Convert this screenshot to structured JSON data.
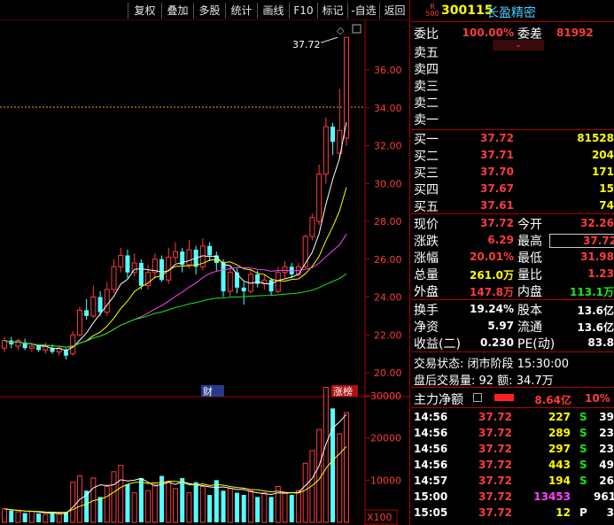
{
  "toolbar": [
    {
      "label": "复权"
    },
    {
      "label": "叠加"
    },
    {
      "label": "多股"
    },
    {
      "label": "统计"
    },
    {
      "label": "画线"
    },
    {
      "label": "F10"
    },
    {
      "label": "标记"
    },
    {
      "label": "-自选"
    },
    {
      "label": "返回"
    }
  ],
  "stock": {
    "market_top": "R",
    "market_bottom": "500",
    "code": "300115",
    "name": "长盈精密"
  },
  "chart": {
    "price_ticks": [
      "36.00",
      "34.00",
      "32.00",
      "30.00",
      "28.00",
      "26.00",
      "24.00",
      "22.00",
      "20.00"
    ],
    "peak_label": "37.72",
    "volume_ticks": [
      "30000",
      "20000",
      "10000"
    ],
    "volume_unit": "X100",
    "tag_caibao": "财",
    "tag_zhangbang": "涨榜",
    "candles": [
      {
        "o": 21.3,
        "c": 21.7,
        "h": 21.9,
        "l": 21.1
      },
      {
        "o": 21.7,
        "c": 21.5,
        "h": 21.9,
        "l": 21.3
      },
      {
        "o": 21.4,
        "c": 21.7,
        "h": 21.8,
        "l": 21.2
      },
      {
        "o": 21.6,
        "c": 21.3,
        "h": 21.8,
        "l": 21.2
      },
      {
        "o": 21.3,
        "c": 21.4,
        "h": 21.6,
        "l": 21.1
      },
      {
        "o": 21.4,
        "c": 21.2,
        "h": 21.5,
        "l": 21.1
      },
      {
        "o": 21.2,
        "c": 21.4,
        "h": 21.6,
        "l": 21.0
      },
      {
        "o": 21.3,
        "c": 21.1,
        "h": 21.5,
        "l": 21.0
      },
      {
        "o": 21.1,
        "c": 21.3,
        "h": 21.4,
        "l": 20.9
      },
      {
        "o": 21.2,
        "c": 20.9,
        "h": 21.3,
        "l": 20.7
      },
      {
        "o": 21.0,
        "c": 22.0,
        "h": 22.2,
        "l": 20.9
      },
      {
        "o": 22.0,
        "c": 23.3,
        "h": 23.5,
        "l": 21.9
      },
      {
        "o": 23.3,
        "c": 23.0,
        "h": 23.9,
        "l": 22.8
      },
      {
        "o": 23.0,
        "c": 24.0,
        "h": 24.6,
        "l": 22.9
      },
      {
        "o": 24.0,
        "c": 23.2,
        "h": 24.3,
        "l": 23.0
      },
      {
        "o": 23.2,
        "c": 24.4,
        "h": 24.8,
        "l": 23.0
      },
      {
        "o": 24.4,
        "c": 25.6,
        "h": 26.0,
        "l": 24.2
      },
      {
        "o": 25.6,
        "c": 26.2,
        "h": 26.6,
        "l": 25.3
      },
      {
        "o": 26.2,
        "c": 25.3,
        "h": 26.5,
        "l": 25.0
      },
      {
        "o": 25.3,
        "c": 25.8,
        "h": 26.3,
        "l": 25.1
      },
      {
        "o": 25.8,
        "c": 24.6,
        "h": 26.0,
        "l": 24.4
      },
      {
        "o": 24.6,
        "c": 25.3,
        "h": 25.7,
        "l": 24.4
      },
      {
        "o": 25.3,
        "c": 26.0,
        "h": 26.3,
        "l": 25.0
      },
      {
        "o": 26.0,
        "c": 24.9,
        "h": 26.2,
        "l": 24.8
      },
      {
        "o": 24.9,
        "c": 26.1,
        "h": 26.6,
        "l": 24.7
      },
      {
        "o": 26.1,
        "c": 26.4,
        "h": 26.9,
        "l": 25.8
      },
      {
        "o": 26.4,
        "c": 25.7,
        "h": 26.6,
        "l": 25.3
      },
      {
        "o": 25.7,
        "c": 26.5,
        "h": 27.0,
        "l": 25.5
      },
      {
        "o": 26.5,
        "c": 25.6,
        "h": 26.7,
        "l": 25.2
      },
      {
        "o": 25.6,
        "c": 26.7,
        "h": 27.1,
        "l": 25.4
      },
      {
        "o": 26.7,
        "c": 26.2,
        "h": 26.9,
        "l": 25.9
      },
      {
        "o": 26.2,
        "c": 25.8,
        "h": 26.4,
        "l": 25.4
      },
      {
        "o": 25.8,
        "c": 24.3,
        "h": 26.0,
        "l": 24.0
      },
      {
        "o": 24.3,
        "c": 25.3,
        "h": 25.6,
        "l": 24.0
      },
      {
        "o": 25.3,
        "c": 24.5,
        "h": 25.5,
        "l": 24.2
      },
      {
        "o": 24.5,
        "c": 24.3,
        "h": 24.8,
        "l": 23.6
      },
      {
        "o": 24.3,
        "c": 25.2,
        "h": 25.5,
        "l": 24.2
      },
      {
        "o": 25.2,
        "c": 24.7,
        "h": 25.4,
        "l": 24.5
      },
      {
        "o": 24.7,
        "c": 24.9,
        "h": 25.2,
        "l": 24.4
      },
      {
        "o": 24.9,
        "c": 24.3,
        "h": 25.0,
        "l": 24.1
      },
      {
        "o": 24.3,
        "c": 25.3,
        "h": 25.6,
        "l": 24.2
      },
      {
        "o": 25.3,
        "c": 25.6,
        "h": 25.9,
        "l": 25.0
      },
      {
        "o": 25.6,
        "c": 25.2,
        "h": 25.8,
        "l": 25.0
      },
      {
        "o": 25.2,
        "c": 25.6,
        "h": 25.8,
        "l": 25.1
      },
      {
        "o": 25.6,
        "c": 27.2,
        "h": 27.3,
        "l": 25.5
      },
      {
        "o": 27.2,
        "c": 28.2,
        "h": 28.4,
        "l": 27.0
      },
      {
        "o": 28.0,
        "c": 30.5,
        "h": 31.0,
        "l": 27.8
      },
      {
        "o": 30.5,
        "c": 33.0,
        "h": 33.5,
        "l": 30.0
      },
      {
        "o": 33.0,
        "c": 32.2,
        "h": 33.2,
        "l": 31.5
      },
      {
        "o": 31.6,
        "c": 32.8,
        "h": 35.0,
        "l": 31.3
      },
      {
        "o": 32.4,
        "c": 37.72,
        "h": 37.72,
        "l": 32.0
      }
    ],
    "volumes": [
      3.2,
      2.8,
      2.5,
      2.2,
      2.6,
      2.1,
      1.8,
      2.2,
      1.9,
      2.4,
      9.5,
      11.0,
      7.5,
      10.5,
      6.0,
      8.5,
      12.0,
      13.5,
      9.0,
      7.0,
      10.5,
      7.5,
      9.0,
      11.0,
      9.5,
      8.0,
      10.5,
      7.0,
      9.5,
      8.5,
      6.5,
      10.0,
      7.5,
      8.0,
      7.0,
      6.5,
      7.5,
      6.0,
      7.0,
      6.0,
      8.5,
      7.0,
      6.5,
      7.5,
      14.0,
      17.0,
      22.0,
      32.0,
      27.0,
      21.0,
      26.0
    ]
  },
  "panel": {
    "webi_label": "委比",
    "webi_val": "100.00%",
    "weicha_label": "委差",
    "weicha_val": "81992",
    "sell": [
      {
        "label": "卖五"
      },
      {
        "label": "卖四"
      },
      {
        "label": "卖三"
      },
      {
        "label": "卖二"
      },
      {
        "label": "卖一"
      }
    ],
    "buy": [
      {
        "label": "买一",
        "price": "37.72",
        "vol": "81528"
      },
      {
        "label": "买二",
        "price": "37.71",
        "vol": "204"
      },
      {
        "label": "买三",
        "price": "37.70",
        "vol": "171"
      },
      {
        "label": "买四",
        "price": "37.67",
        "vol": "15"
      },
      {
        "label": "买五",
        "price": "37.61",
        "vol": "74"
      }
    ],
    "stats": [
      {
        "l1": "现价",
        "v1": "37.72",
        "c1": "red",
        "l2": "今开",
        "v2": "32.26",
        "c2": "red"
      },
      {
        "l1": "涨跌",
        "v1": "6.29",
        "c1": "red",
        "l2": "最高",
        "v2": "37.72",
        "c2": "red"
      },
      {
        "l1": "涨幅",
        "v1": "20.01%",
        "c1": "red",
        "l2": "最低",
        "v2": "31.98",
        "c2": "red"
      },
      {
        "l1": "总量",
        "v1": "261.0万",
        "c1": "yel",
        "l2": "量比",
        "v2": "1.23",
        "c2": "red"
      },
      {
        "l1": "外盘",
        "v1": "147.8万",
        "c1": "red",
        "l2": "内盘",
        "v2": "113.1万",
        "c2": "grn"
      }
    ],
    "stats2": [
      {
        "l1": "换手",
        "v1": "19.24%",
        "l2": "股本",
        "v2": "13.6亿"
      },
      {
        "l1": "净资",
        "v1": "5.97",
        "l2": "流通",
        "v2": "13.6亿"
      },
      {
        "l1": "收益(二)",
        "v1": "0.230",
        "l2": "PE(动)",
        "v2": "83.8"
      }
    ],
    "trade_status": "交易状态: 闭市阶段 15:30:00",
    "after_trade": "盘后交易量: 92  额: 34.7万",
    "main_label": "主力净额",
    "main_val": "8.64亿",
    "main_pct": "10%",
    "ticks": [
      {
        "t": "14:56",
        "p": "37.72",
        "v": "227",
        "d": "S",
        "x": "39"
      },
      {
        "t": "14:56",
        "p": "37.72",
        "v": "289",
        "d": "S",
        "x": "23"
      },
      {
        "t": "14:56",
        "p": "37.72",
        "v": "297",
        "d": "S",
        "x": "23"
      },
      {
        "t": "14:56",
        "p": "37.72",
        "v": "443",
        "d": "S",
        "x": "49"
      },
      {
        "t": "14:57",
        "p": "37.72",
        "v": "194",
        "d": "S",
        "x": "26"
      },
      {
        "t": "15:00",
        "p": "37.72",
        "v": "13453",
        "d": "",
        "x": "961"
      },
      {
        "t": "15:05",
        "p": "37.72",
        "v": "12",
        "d": "P",
        "x": "3"
      }
    ]
  },
  "colors": {
    "up": "#ff3b3b",
    "down": "#54ffff",
    "ma5": "#ffffff",
    "ma10": "#ffff00",
    "ma20": "#ff44ff",
    "ma60": "#18e818",
    "grid": "#b00000"
  }
}
